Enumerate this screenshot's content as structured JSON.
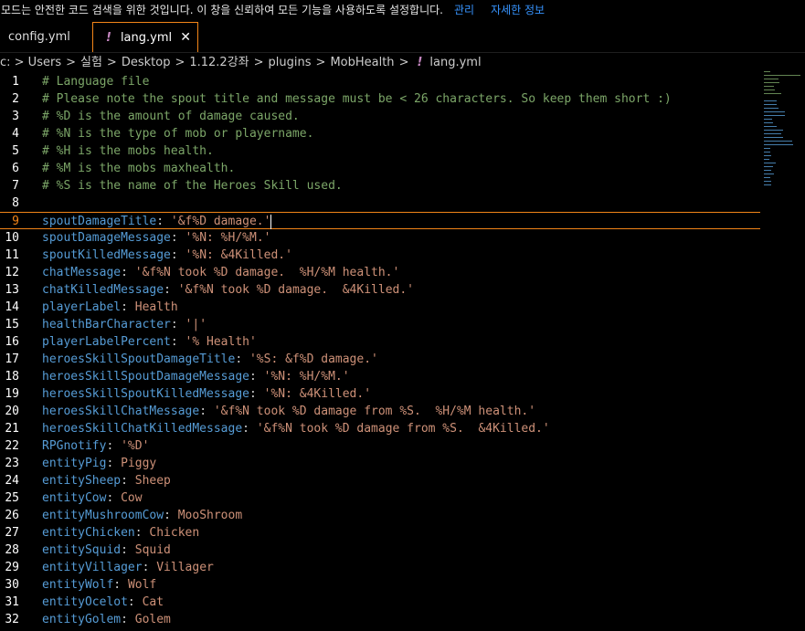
{
  "banner": {
    "message": "모드는 안전한 코드 검색을 위한 것입니다. 이 창을 신뢰하여 모든 기능을 사용하도록 설정합니다.",
    "manage_link": "관리",
    "details_link": "자세한 정보"
  },
  "tabs": [
    {
      "label": "config.yml",
      "active": false
    },
    {
      "label": "lang.yml",
      "active": true,
      "icon": "!",
      "close": "✕"
    }
  ],
  "breadcrumb": {
    "segments": [
      "c: > Users",
      "실험",
      "Desktop",
      "1.12.2강좌",
      "plugins",
      "MobHealth"
    ],
    "file_icon": "!",
    "file": "lang.yml"
  },
  "colors": {
    "accent": "#f38518",
    "comment": "#7ca668",
    "key": "#569cd6",
    "string": "#ce9178",
    "link": "#3794ff"
  },
  "lines": [
    {
      "num": "1",
      "comment": "# Language file"
    },
    {
      "num": "2",
      "comment": "# Please note the spout title and message must be < 26 characters. So keep them short :)"
    },
    {
      "num": "3",
      "comment": "# %D is the amount of damage caused."
    },
    {
      "num": "4",
      "comment": "# %N is the type of mob or playername."
    },
    {
      "num": "5",
      "comment": "# %H is the mobs health."
    },
    {
      "num": "6",
      "comment": "# %M is the mobs maxhealth."
    },
    {
      "num": "7",
      "comment": "# %S is the name of the Heroes Skill used."
    },
    {
      "num": "8"
    },
    {
      "num": "9",
      "key": "spoutDamageTitle",
      "value": "'&f%D damage.'",
      "current": true
    },
    {
      "num": "10",
      "key": "spoutDamageMessage",
      "value": "'%N: %H/%M.'"
    },
    {
      "num": "11",
      "key": "spoutKilledMessage",
      "value": "'%N: &4Killed.'"
    },
    {
      "num": "12",
      "key": "chatMessage",
      "value": "'&f%N took %D damage.  %H/%M health.'"
    },
    {
      "num": "13",
      "key": "chatKilledMessage",
      "value": "'&f%N took %D damage.  &4Killed.'"
    },
    {
      "num": "14",
      "key": "playerLabel",
      "value": "Health"
    },
    {
      "num": "15",
      "key": "healthBarCharacter",
      "value": "'|'"
    },
    {
      "num": "16",
      "key": "playerLabelPercent",
      "value": "'% Health'"
    },
    {
      "num": "17",
      "key": "heroesSkillSpoutDamageTitle",
      "value": "'%S: &f%D damage.'"
    },
    {
      "num": "18",
      "key": "heroesSkillSpoutDamageMessage",
      "value": "'%N: %H/%M.'"
    },
    {
      "num": "19",
      "key": "heroesSkillSpoutKilledMessage",
      "value": "'%N: &4Killed.'"
    },
    {
      "num": "20",
      "key": "heroesSkillChatMessage",
      "value": "'&f%N took %D damage from %S.  %H/%M health.'"
    },
    {
      "num": "21",
      "key": "heroesSkillChatKilledMessage",
      "value": "'&f%N took %D damage from %S.  &4Killed.'"
    },
    {
      "num": "22",
      "key": "RPGnotify",
      "value": "'%D'"
    },
    {
      "num": "23",
      "key": "entityPig",
      "value": "Piggy"
    },
    {
      "num": "24",
      "key": "entitySheep",
      "value": "Sheep"
    },
    {
      "num": "25",
      "key": "entityCow",
      "value": "Cow"
    },
    {
      "num": "26",
      "key": "entityMushroomCow",
      "value": "MooShroom"
    },
    {
      "num": "27",
      "key": "entityChicken",
      "value": "Chicken"
    },
    {
      "num": "28",
      "key": "entitySquid",
      "value": "Squid"
    },
    {
      "num": "29",
      "key": "entityVillager",
      "value": "Villager"
    },
    {
      "num": "30",
      "key": "entityWolf",
      "value": "Wolf"
    },
    {
      "num": "31",
      "key": "entityOcelot",
      "value": "Cat"
    },
    {
      "num": "32",
      "key": "entityGolem",
      "value": "Golem"
    }
  ]
}
